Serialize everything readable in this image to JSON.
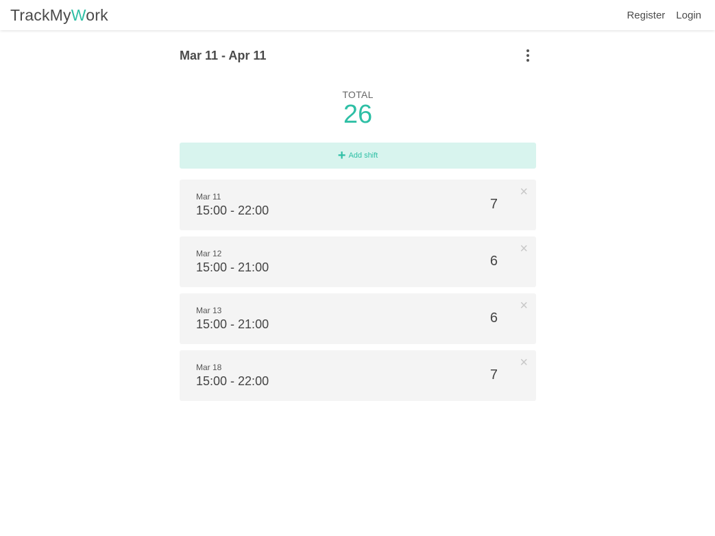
{
  "header": {
    "logo_part1": "TrackMy",
    "logo_accent": "W",
    "logo_part2": "ork",
    "nav": {
      "register": "Register",
      "login": "Login"
    }
  },
  "period": {
    "range": "Mar 11 - Apr 11",
    "menu_icon": "more-vertical-icon"
  },
  "summary": {
    "label": "TOTAL",
    "value": "26"
  },
  "add_button": {
    "icon": "+",
    "label": "Add shift"
  },
  "shifts": [
    {
      "date": "Mar 11",
      "time": "15:00 - 22:00",
      "hours": "7",
      "close": "×"
    },
    {
      "date": "Mar 12",
      "time": "15:00 - 21:00",
      "hours": "6",
      "close": "×"
    },
    {
      "date": "Mar 13",
      "time": "15:00 - 21:00",
      "hours": "6",
      "close": "×"
    },
    {
      "date": "Mar 18",
      "time": "15:00 - 22:00",
      "hours": "7",
      "close": "×"
    }
  ],
  "colors": {
    "accent": "#2ebfa5",
    "accent_light": "#d8f4ee",
    "card_bg": "#f4f4f4"
  }
}
